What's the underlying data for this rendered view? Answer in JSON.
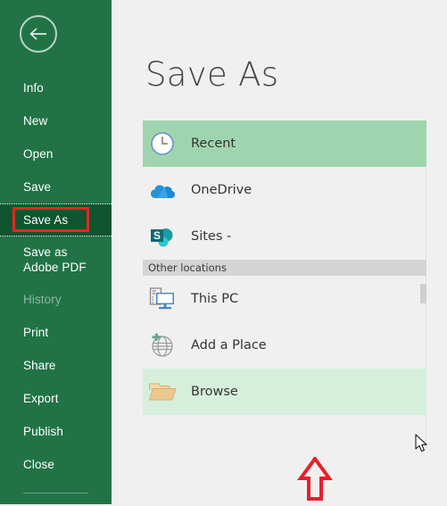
{
  "app": {
    "name": "Microsoft Excel Backstage",
    "accent_green": "#217346",
    "selected_green": "#0e5530",
    "highlight_strong": "#9fd5ae",
    "highlight_soft": "#d6efdd",
    "annotation_red": "#ee2222"
  },
  "sidebar": {
    "back_button": "back-arrow",
    "items": [
      {
        "label": "Info",
        "state": "normal",
        "icon": "none"
      },
      {
        "label": "New",
        "state": "normal",
        "icon": "none"
      },
      {
        "label": "Open",
        "state": "normal",
        "icon": "none"
      },
      {
        "label": "Save",
        "state": "normal",
        "icon": "none"
      },
      {
        "label": "Save As",
        "state": "selected",
        "icon": "none"
      },
      {
        "label": "Save as Adobe PDF",
        "state": "normal",
        "icon": "none"
      },
      {
        "label": "History",
        "state": "disabled",
        "icon": "none"
      },
      {
        "label": "Print",
        "state": "normal",
        "icon": "none"
      },
      {
        "label": "Share",
        "state": "normal",
        "icon": "none"
      },
      {
        "label": "Export",
        "state": "normal",
        "icon": "none"
      },
      {
        "label": "Publish",
        "state": "normal",
        "icon": "none"
      },
      {
        "label": "Close",
        "state": "normal",
        "icon": "none"
      }
    ]
  },
  "main": {
    "title": "Save As",
    "places": [
      {
        "label": "Recent",
        "icon": "clock-icon",
        "highlight": "strong"
      },
      {
        "label": "OneDrive",
        "icon": "onedrive-icon",
        "highlight": "none"
      },
      {
        "label": "Sites -",
        "icon": "sharepoint-icon",
        "highlight": "none"
      }
    ],
    "other_locations_header": "Other locations",
    "other_locations": [
      {
        "label": "This PC",
        "icon": "computer-icon",
        "highlight": "none"
      },
      {
        "label": "Add a Place",
        "icon": "add-place-icon",
        "highlight": "none"
      },
      {
        "label": "Browse",
        "icon": "folder-icon",
        "highlight": "soft"
      }
    ]
  },
  "annotations": {
    "save_as_box": "red-rectangle-highlight",
    "browse_arrow": "red-up-arrow",
    "cursor": "mouse-pointer"
  }
}
